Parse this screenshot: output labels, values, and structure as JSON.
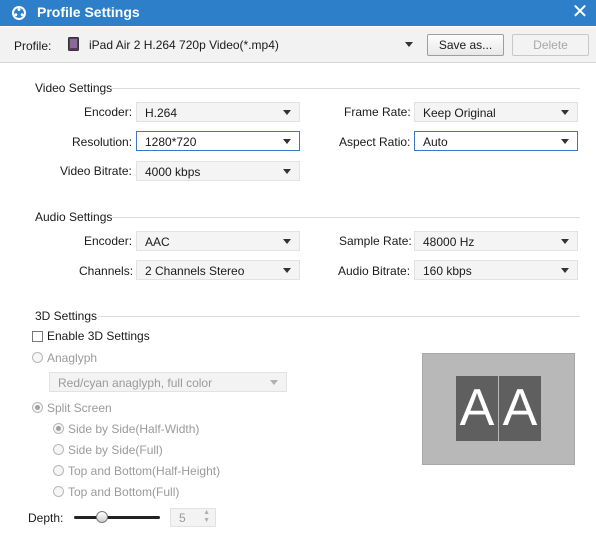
{
  "window": {
    "title": "Profile Settings"
  },
  "profile": {
    "label": "Profile:",
    "value": "iPad Air 2 H.264 720p Video(*.mp4)",
    "save_as": "Save as...",
    "delete": "Delete"
  },
  "video": {
    "heading": "Video Settings",
    "encoder_label": "Encoder:",
    "encoder": "H.264",
    "frame_rate_label": "Frame Rate:",
    "frame_rate": "Keep Original",
    "resolution_label": "Resolution:",
    "resolution": "1280*720",
    "aspect_label": "Aspect Ratio:",
    "aspect": "Auto",
    "bitrate_label": "Video Bitrate:",
    "bitrate": "4000 kbps"
  },
  "audio": {
    "heading": "Audio Settings",
    "encoder_label": "Encoder:",
    "encoder": "AAC",
    "sample_rate_label": "Sample Rate:",
    "sample_rate": "48000 Hz",
    "channels_label": "Channels:",
    "channels": "2 Channels Stereo",
    "bitrate_label": "Audio Bitrate:",
    "bitrate": "160 kbps"
  },
  "three_d": {
    "heading": "3D Settings",
    "enable_label": "Enable 3D Settings",
    "enabled": false,
    "anaglyph_label": "Anaglyph",
    "anaglyph_value": "Red/cyan anaglyph, full color",
    "split_label": "Split Screen",
    "options": [
      "Side by Side(Half-Width)",
      "Side by Side(Full)",
      "Top and Bottom(Half-Height)",
      "Top and Bottom(Full)"
    ],
    "depth_label": "Depth:",
    "depth_value": "5",
    "depth_level": 0.3,
    "preview_left": "A",
    "preview_right": "A"
  }
}
